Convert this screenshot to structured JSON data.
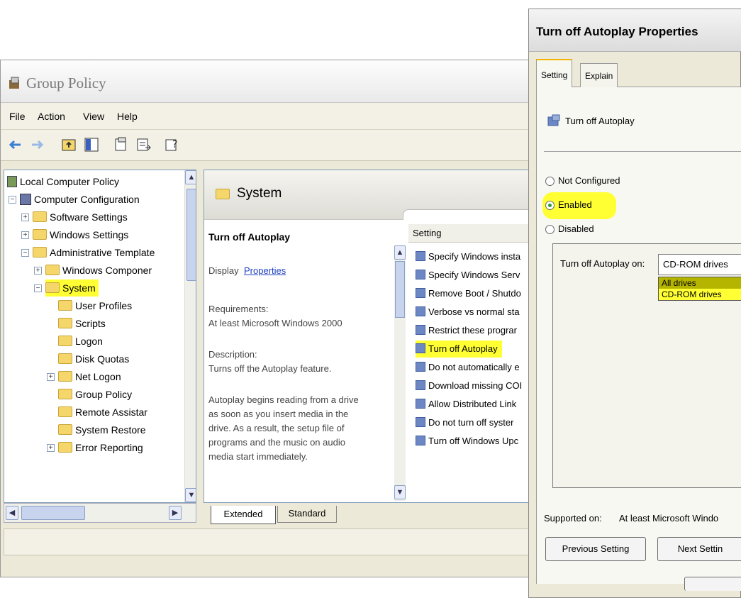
{
  "group_policy": {
    "title": "Group Policy",
    "menu": [
      "File",
      "Action",
      "View",
      "Help"
    ],
    "tree": [
      {
        "label": "Local Computer Policy"
      },
      {
        "label": "Computer Configuration"
      },
      {
        "label": "Software Settings"
      },
      {
        "label": "Windows Settings"
      },
      {
        "label": "Administrative Template"
      },
      {
        "label": "Windows Componer"
      },
      {
        "label": "System"
      },
      {
        "label": "User Profiles"
      },
      {
        "label": "Scripts"
      },
      {
        "label": "Logon"
      },
      {
        "label": "Disk Quotas"
      },
      {
        "label": "Net Logon"
      },
      {
        "label": "Group Policy"
      },
      {
        "label": "Remote Assistar"
      },
      {
        "label": "System Restore"
      },
      {
        "label": "Error Reporting"
      }
    ],
    "pane_title": "System",
    "policy_title": "Turn off Autoplay",
    "display_prefix": "Display",
    "display_link": "Properties",
    "requirements_label": "Requirements:",
    "requirements_value": "At least Microsoft Windows 2000",
    "description_label": "Description:",
    "description_value": "Turns off the Autoplay feature.",
    "description_more": [
      "Autoplay begins reading from a drive",
      "as soon as you insert media in the",
      "drive. As a result, the setup file of",
      "programs and the music on audio",
      "media start immediately."
    ],
    "list_header": "Setting",
    "settings": [
      "Specify Windows insta",
      "Specify Windows Serv",
      "Remove Boot / Shutdo",
      "Verbose vs normal sta",
      "Restrict these prograr",
      "Turn off Autoplay",
      "Do not automatically e",
      "Download missing COI",
      "Allow Distributed Link",
      "Do not turn off syster",
      "Turn off Windows Upc"
    ],
    "tabs": [
      "Extended",
      "Standard"
    ]
  },
  "dialog": {
    "title": "Turn off Autoplay Properties",
    "tabs": [
      "Setting",
      "Explain"
    ],
    "policy_name": "Turn off Autoplay",
    "radio_not_configured": "Not Configured",
    "radio_enabled": "Enabled",
    "radio_disabled": "Disabled",
    "selected": "Enabled",
    "option_label": "Turn off Autoplay on:",
    "option_value": "CD-ROM drives",
    "dropdown_options": [
      "All drives",
      "CD-ROM drives"
    ],
    "supported_label": "Supported on:",
    "supported_value": "At least Microsoft Windo",
    "prev_button": "Previous Setting",
    "next_button": "Next Settin"
  },
  "colors": {
    "highlight": "#ffff33",
    "dropdown_selected": "#b5b500"
  }
}
